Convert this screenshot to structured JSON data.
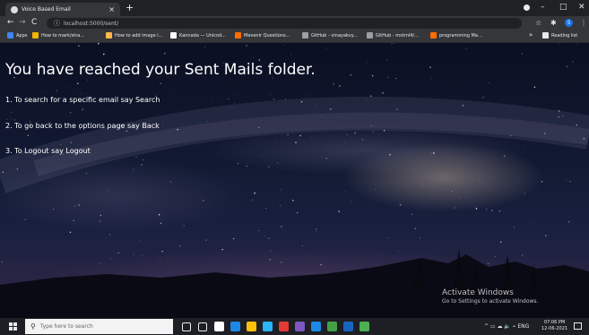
{
  "browser": {
    "tab_title": "Voice Based Email",
    "tab_close": "×",
    "new_tab": "+",
    "url": "localhost:5000/sent/",
    "nav": {
      "back": "←",
      "forward": "→",
      "reload": "C",
      "info": "ⓘ"
    },
    "window": {
      "minimize": "–",
      "maximize": "□",
      "close": "✕"
    },
    "extensions": {
      "star": "☆",
      "puzzle": "✱",
      "profile": "S",
      "menu": "⋮"
    },
    "bookmarks": [
      {
        "label": "Apps",
        "color": "#4285f4"
      },
      {
        "label": "How to mark/stra...",
        "color": "#f4b400"
      },
      {
        "label": "How to add image i...",
        "color": "#ffb74d"
      },
      {
        "label": "Kannada — Unicod...",
        "color": "#ffffff"
      },
      {
        "label": "Mavenir Questions...",
        "color": "#ff6d00"
      },
      {
        "label": "GitHub - vinayakvy...",
        "color": "#9aa0a6"
      },
      {
        "label": "GitHub - mstrnl4/...",
        "color": "#9aa0a6"
      },
      {
        "label": "programming Ma...",
        "color": "#ff6d00"
      }
    ],
    "bookmarks_more": "»",
    "reading_list": "Reading list"
  },
  "page": {
    "heading": "You have reached your Sent Mails folder.",
    "instructions": [
      "1. To search for a specific email say Search",
      "2. To go back to the options page say Back",
      "3. To Logout say Logout"
    ],
    "watermark": {
      "title": "Activate Windows",
      "subtitle": "Go to Settings to activate Windows."
    }
  },
  "taskbar": {
    "search_placeholder": "Type here to search",
    "tray_text": "^ ▭ ☁ 🔈 ⌁ ENG",
    "time": "07:06 PM",
    "date": "12-06-2021",
    "app_icon_colors": [
      "#e8eaed",
      "#e8eaed",
      "#ffffff",
      "#1e88e5",
      "#ffc107",
      "#29b6f6",
      "#e53935",
      "#7e57c2",
      "#1e88e5",
      "#43a047",
      "#1565c0",
      "#4caf50"
    ]
  }
}
